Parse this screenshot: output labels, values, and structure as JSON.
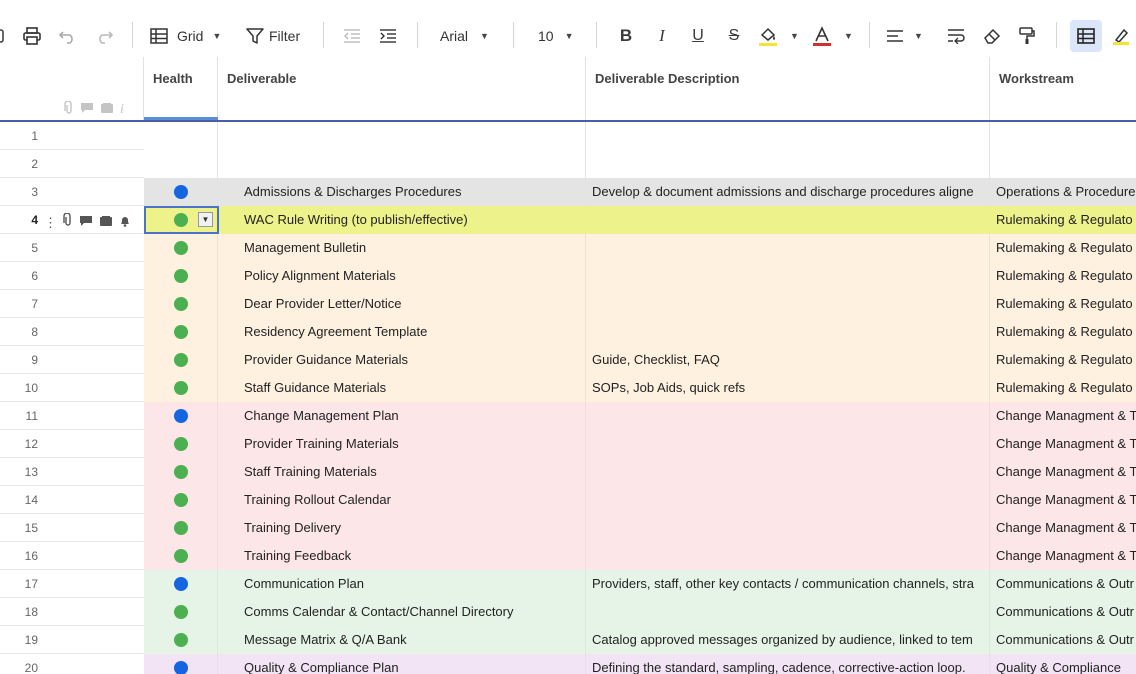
{
  "toolbar": {
    "view_label": "Grid",
    "filter_label": "Filter",
    "font_family": "Arial",
    "font_size": "10",
    "text_color_accent": "#d32f2f",
    "fill_color_accent": "#f3e43a",
    "active_view_icon": "grid-view-icon"
  },
  "columns": {
    "health": "Health",
    "deliverable": "Deliverable",
    "description": "Deliverable Description",
    "workstream": "Workstream"
  },
  "rows": [
    {
      "num": "1",
      "health": "",
      "deliverable": "",
      "description": "",
      "workstream": "",
      "bg": "#ffffff"
    },
    {
      "num": "2",
      "health": "",
      "deliverable": "",
      "description": "",
      "workstream": "",
      "bg": "#ffffff"
    },
    {
      "num": "3",
      "health": "blue",
      "deliverable": "Admissions & Discharges Procedures",
      "description": "Develop & document admissions and discharge procedures aligne",
      "workstream": "Operations & Procedure",
      "bg": "#e4e4e4"
    },
    {
      "num": "4",
      "health": "green",
      "deliverable": "WAC Rule Writing (to publish/effective)",
      "description": "",
      "workstream": "Rulemaking & Regulato",
      "bg": "#eef28a",
      "selected": true
    },
    {
      "num": "5",
      "health": "green",
      "deliverable": "Management Bulletin",
      "description": "",
      "workstream": "Rulemaking & Regulato",
      "bg": "#fff1df"
    },
    {
      "num": "6",
      "health": "green",
      "deliverable": "Policy Alignment Materials",
      "description": "",
      "workstream": "Rulemaking & Regulato",
      "bg": "#fff1df"
    },
    {
      "num": "7",
      "health": "green",
      "deliverable": "Dear Provider Letter/Notice",
      "description": "",
      "workstream": "Rulemaking & Regulato",
      "bg": "#fff1df"
    },
    {
      "num": "8",
      "health": "green",
      "deliverable": "Residency Agreement Template",
      "description": "",
      "workstream": "Rulemaking & Regulato",
      "bg": "#fff1df"
    },
    {
      "num": "9",
      "health": "green",
      "deliverable": "Provider Guidance Materials",
      "description": "Guide, Checklist, FAQ",
      "workstream": "Rulemaking & Regulato",
      "bg": "#fff1df"
    },
    {
      "num": "10",
      "health": "green",
      "deliverable": "Staff Guidance Materials",
      "description": "SOPs, Job Aids, quick refs",
      "workstream": "Rulemaking & Regulato",
      "bg": "#fff1df"
    },
    {
      "num": "11",
      "health": "blue",
      "deliverable": "Change Management Plan",
      "description": "",
      "workstream": "Change Managment & T",
      "bg": "#fde6e8"
    },
    {
      "num": "12",
      "health": "green",
      "deliverable": "Provider Training Materials",
      "description": "",
      "workstream": "Change Managment & T",
      "bg": "#fde6e8"
    },
    {
      "num": "13",
      "health": "green",
      "deliverable": "Staff Training Materials",
      "description": "",
      "workstream": "Change Managment & T",
      "bg": "#fde6e8"
    },
    {
      "num": "14",
      "health": "green",
      "deliverable": "Training Rollout Calendar",
      "description": "",
      "workstream": "Change Managment & T",
      "bg": "#fde6e8"
    },
    {
      "num": "15",
      "health": "green",
      "deliverable": "Training Delivery",
      "description": "",
      "workstream": "Change Managment & T",
      "bg": "#fde6e8"
    },
    {
      "num": "16",
      "health": "green",
      "deliverable": "Training Feedback",
      "description": "",
      "workstream": "Change Managment & T",
      "bg": "#fde6e8"
    },
    {
      "num": "17",
      "health": "blue",
      "deliverable": "Communication Plan",
      "description": "Providers, staff, other key contacts / communication channels, stra",
      "workstream": "Communications & Outr",
      "bg": "#e6f4e7"
    },
    {
      "num": "18",
      "health": "green",
      "deliverable": "Comms Calendar & Contact/Channel Directory",
      "description": "",
      "workstream": "Communications & Outr",
      "bg": "#e6f4e7"
    },
    {
      "num": "19",
      "health": "green",
      "deliverable": "Message Matrix & Q/A Bank",
      "description": "Catalog approved messages organized by audience, linked to tem",
      "workstream": "Communications & Outr",
      "bg": "#e6f4e7"
    },
    {
      "num": "20",
      "health": "blue",
      "deliverable": "Quality & Compliance Plan",
      "description": "Defining the standard, sampling, cadence, corrective-action loop.",
      "workstream": "Quality & Compliance",
      "bg": "#f3e4f5"
    }
  ]
}
